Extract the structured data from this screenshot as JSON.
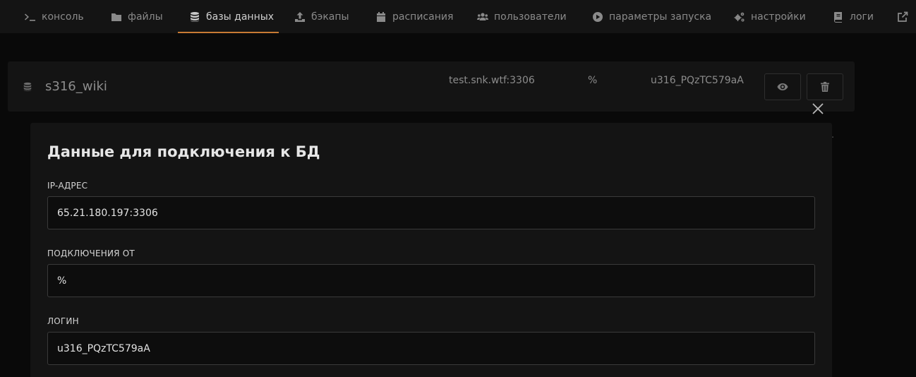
{
  "nav": {
    "items": [
      {
        "label": "консоль",
        "icon": "terminal-icon"
      },
      {
        "label": "файлы",
        "icon": "folder-icon"
      },
      {
        "label": "базы данных",
        "icon": "database-icon",
        "active": true
      },
      {
        "label": "бэкапы",
        "icon": "upload-icon"
      },
      {
        "label": "расписания",
        "icon": "calendar-icon"
      },
      {
        "label": "пользователи",
        "icon": "users-icon"
      },
      {
        "label": "параметры запуска",
        "icon": "play-circle-icon"
      },
      {
        "label": "настройки",
        "icon": "gears-icon"
      },
      {
        "label": "логи",
        "icon": "book-icon"
      }
    ],
    "external_icon": "external-link-icon",
    "accent_color": "#c77a34"
  },
  "database": {
    "name": "s316_wiki",
    "host": "test.snk.wtf:3306",
    "connections_from": "%",
    "username": "u316_PQzTC579aA"
  },
  "modal": {
    "title": "Данные для подключения к БД",
    "fields": [
      {
        "label": "IP-АДРЕС",
        "value": "65.21.180.197:3306"
      },
      {
        "label": "ПОДКЛЮЧЕНИЯ ОТ",
        "value": "%"
      },
      {
        "label": "ЛОГИН",
        "value": "u316_PQzTC579aA"
      }
    ]
  }
}
